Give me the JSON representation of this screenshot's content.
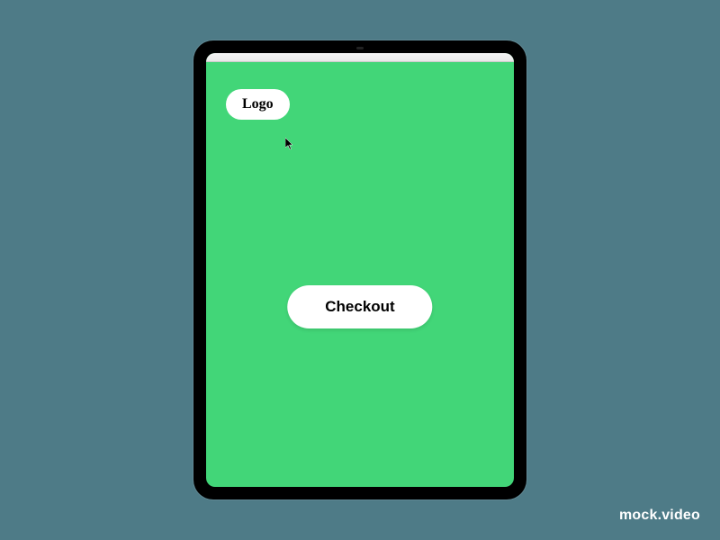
{
  "header": {
    "logo_label": "Logo"
  },
  "main": {
    "checkout_label": "Checkout"
  },
  "watermark": "mock.video",
  "colors": {
    "background": "#4e7b87",
    "screen": "#42d678",
    "pill": "#ffffff"
  }
}
